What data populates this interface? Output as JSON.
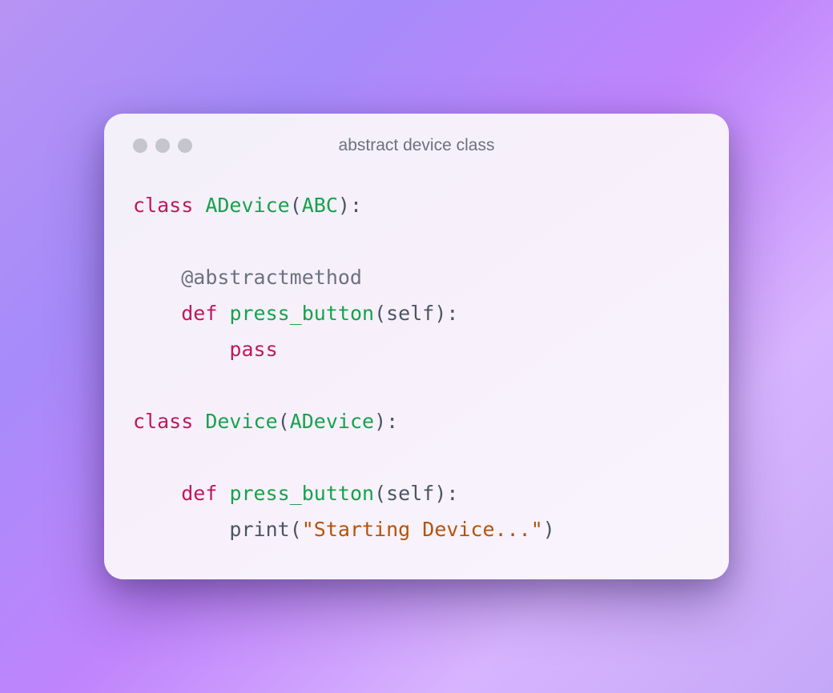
{
  "window": {
    "title": "abstract device class"
  },
  "code": {
    "line1": {
      "kw": "class",
      "name": "ADevice",
      "paren_open": "(",
      "base": "ABC",
      "paren_close": "):"
    },
    "line3": {
      "indent": "    ",
      "decorator": "@abstractmethod"
    },
    "line4": {
      "indent": "    ",
      "kw": "def",
      "name": "press_button",
      "paren_open": "(",
      "param": "self",
      "paren_close": "):"
    },
    "line5": {
      "indent": "        ",
      "kw": "pass"
    },
    "line7": {
      "kw": "class",
      "name": "Device",
      "paren_open": "(",
      "base": "ADevice",
      "paren_close": "):"
    },
    "line9": {
      "indent": "    ",
      "kw": "def",
      "name": "press_button",
      "paren_open": "(",
      "param": "self",
      "paren_close": "):"
    },
    "line10": {
      "indent": "        ",
      "call": "print",
      "paren_open": "(",
      "string": "\"Starting Device...\"",
      "paren_close": ")"
    }
  }
}
